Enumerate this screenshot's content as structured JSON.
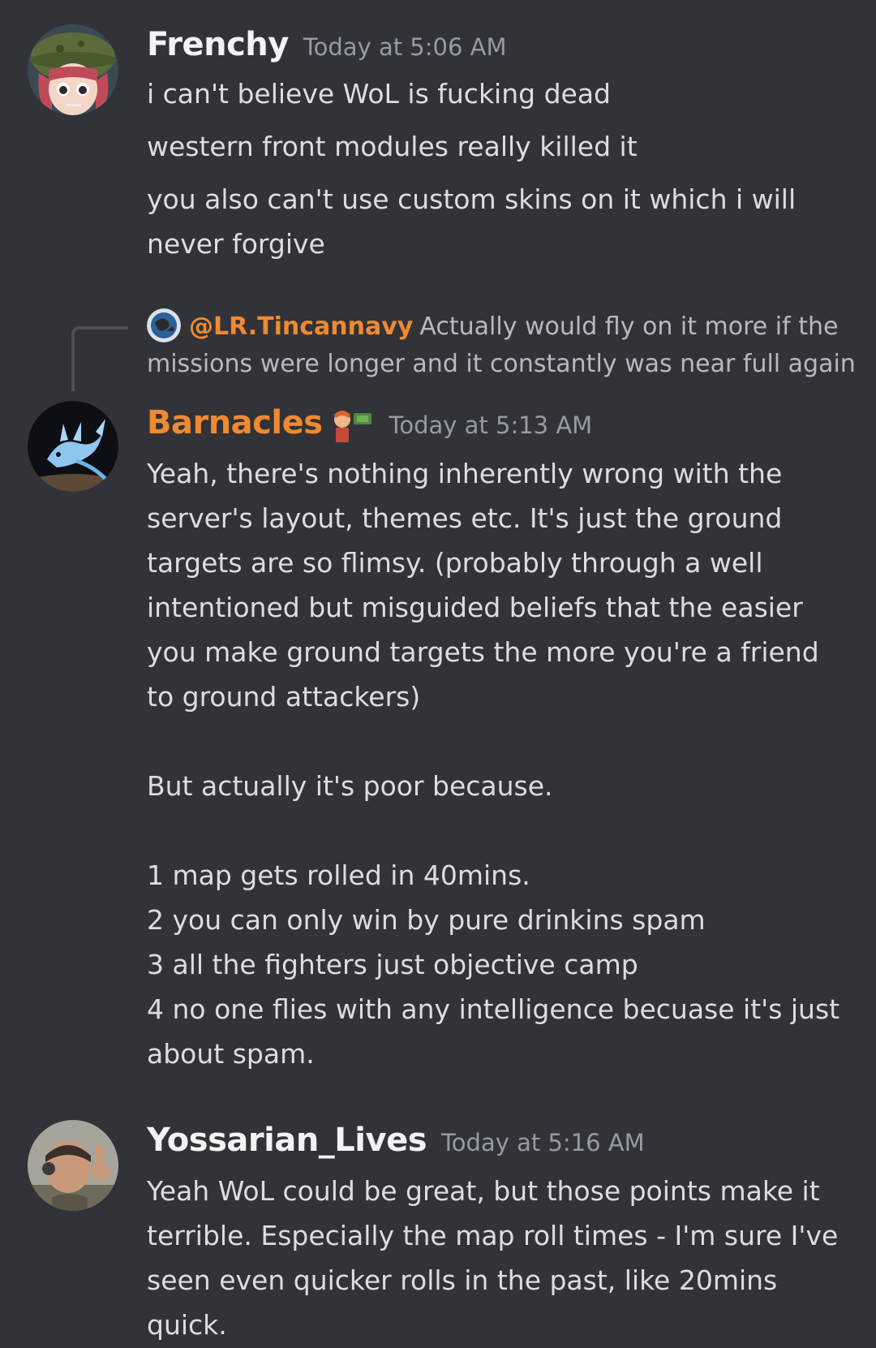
{
  "messages": [
    {
      "username": "Frenchy",
      "username_color": "#f2f3f5",
      "timestamp": "Today at 5:06 AM",
      "avatar": "helmet-girl-avatar",
      "lines": [
        "i can't believe WoL is fucking dead",
        "western front modules really killed it",
        "you also can't use custom skins on it which i will",
        "never forgive"
      ]
    },
    {
      "reply": {
        "mention": "@LR.Tincannavy",
        "text_line1": "Actually would fly on it more if the",
        "text_line2": "missions were longer and it constantly was near full again",
        "avatar": "globe-avatar"
      },
      "username": "Barnacles",
      "username_color": "#f0892f",
      "timestamp": "Today at 5:13 AM",
      "avatar": "blue-dragon-avatar",
      "badge": "fry-money-emoji",
      "lines": [
        "Yeah, there's nothing inherently wrong with the",
        "server's layout, themes etc. It's just the ground",
        "targets are so flimsy. (probably through a well",
        "intentioned but misguided beliefs that the easier",
        "you make ground targets the more you're a friend",
        "to ground attackers)",
        "But actually it's poor because.",
        "1 map gets rolled in 40mins.",
        "2 you can only win by pure drinkins spam",
        "3 all the fighters just objective camp",
        "4 no one flies with any intelligence becuase it's just",
        "about spam."
      ]
    },
    {
      "username": "Yossarian_Lives",
      "username_color": "#f2f3f5",
      "timestamp": "Today at 5:16 AM",
      "avatar": "pilot-avatar",
      "lines": [
        "Yeah WoL could be great, but those points make it",
        "terrible. Especially the map roll times - I'm sure I've",
        "seen even quicker rolls in the past, like 20mins",
        "quick."
      ]
    }
  ]
}
